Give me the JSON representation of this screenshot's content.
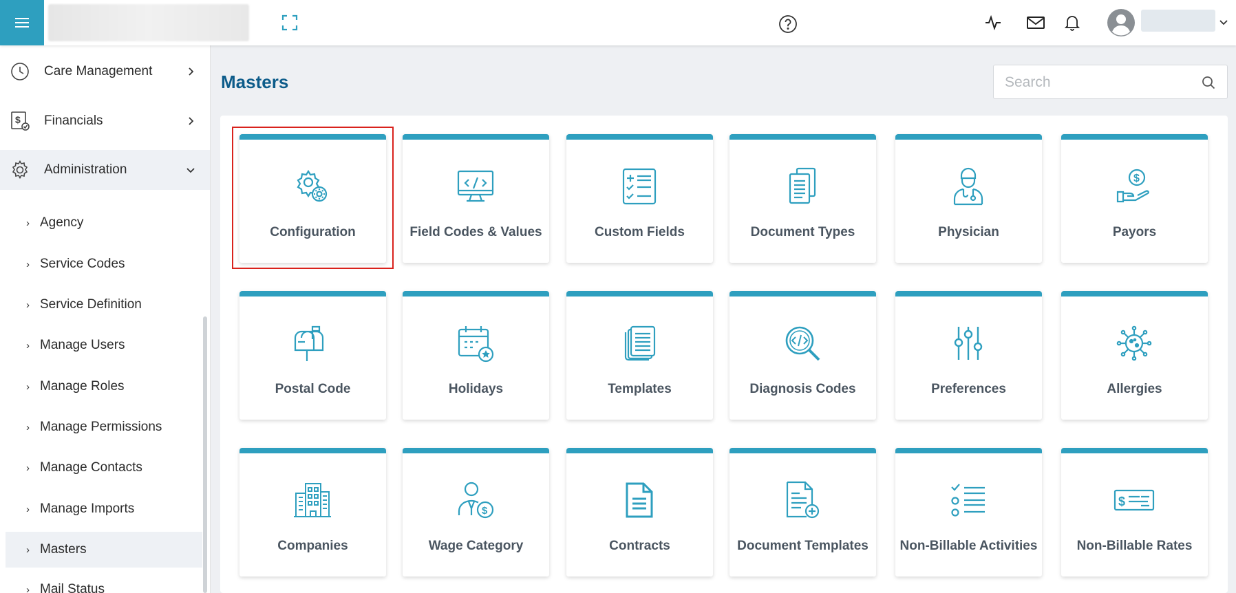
{
  "page": {
    "title": "Masters"
  },
  "search": {
    "placeholder": "Search"
  },
  "sidebar": {
    "main_items": [
      {
        "label": "Care Management"
      },
      {
        "label": "Financials"
      },
      {
        "label": "Administration"
      }
    ],
    "sub_items": [
      {
        "label": "Agency"
      },
      {
        "label": "Service Codes"
      },
      {
        "label": "Service Definition"
      },
      {
        "label": "Manage Users"
      },
      {
        "label": "Manage Roles"
      },
      {
        "label": "Manage Permissions"
      },
      {
        "label": "Manage Contacts"
      },
      {
        "label": "Manage Imports"
      },
      {
        "label": "Masters"
      },
      {
        "label": "Mail Status"
      }
    ],
    "selected_sub": "Masters"
  },
  "tiles": [
    {
      "label": "Configuration",
      "icon": "gear-cog-icon"
    },
    {
      "label": "Field Codes & Values",
      "icon": "code-monitor-icon"
    },
    {
      "label": "Custom Fields",
      "icon": "checklist-icon"
    },
    {
      "label": "Document Types",
      "icon": "documents-stack-icon"
    },
    {
      "label": "Physician",
      "icon": "doctor-icon"
    },
    {
      "label": "Payors",
      "icon": "hand-dollar-icon"
    },
    {
      "label": "Postal Code",
      "icon": "mailbox-icon"
    },
    {
      "label": "Holidays",
      "icon": "calendar-star-icon"
    },
    {
      "label": "Templates",
      "icon": "template-pages-icon"
    },
    {
      "label": "Diagnosis Codes",
      "icon": "code-search-icon"
    },
    {
      "label": "Preferences",
      "icon": "sliders-icon"
    },
    {
      "label": "Allergies",
      "icon": "virus-icon"
    },
    {
      "label": "Companies",
      "icon": "buildings-icon"
    },
    {
      "label": "Wage Category",
      "icon": "person-dollar-icon"
    },
    {
      "label": "Contracts",
      "icon": "contract-document-icon"
    },
    {
      "label": "Document Templates",
      "icon": "document-add-icon"
    },
    {
      "label": "Non-Billable Activities",
      "icon": "list-check-icon"
    },
    {
      "label": "Non-Billable Rates",
      "icon": "cheque-icon"
    }
  ],
  "colors": {
    "accent": "#2e9fbf",
    "title": "#0d5c8a",
    "highlight": "#d9221c"
  }
}
